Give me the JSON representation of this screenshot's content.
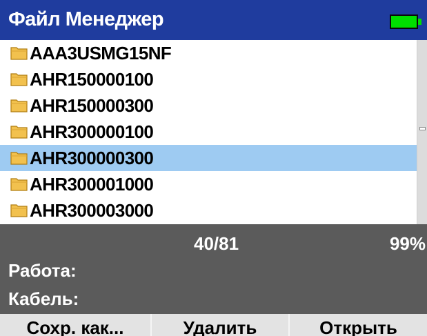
{
  "header": {
    "title": "Файл Менеджер",
    "battery_icon": "battery-icon",
    "battery_color": "#00e000",
    "bar_color": "#1f3c9e"
  },
  "file_list": {
    "folder_icon": "folder-icon",
    "selected_color": "#9ecbf2",
    "items": [
      {
        "name": "AAA3USMG15NF",
        "selected": false
      },
      {
        "name": "AHR150000100",
        "selected": false
      },
      {
        "name": "AHR150000300",
        "selected": false
      },
      {
        "name": "AHR300000100",
        "selected": false
      },
      {
        "name": "AHR300000300",
        "selected": true
      },
      {
        "name": "AHR300001000",
        "selected": false
      },
      {
        "name": "AHR300003000",
        "selected": false
      }
    ]
  },
  "status": {
    "count": "40/81",
    "percent": "99%",
    "work_label": "Работа:",
    "cable_label": "Кабель:",
    "panel_color": "#5b5b5b"
  },
  "buttons": {
    "save_as": "Сохр. как...",
    "delete": "Удалить",
    "open": "Открыть"
  }
}
